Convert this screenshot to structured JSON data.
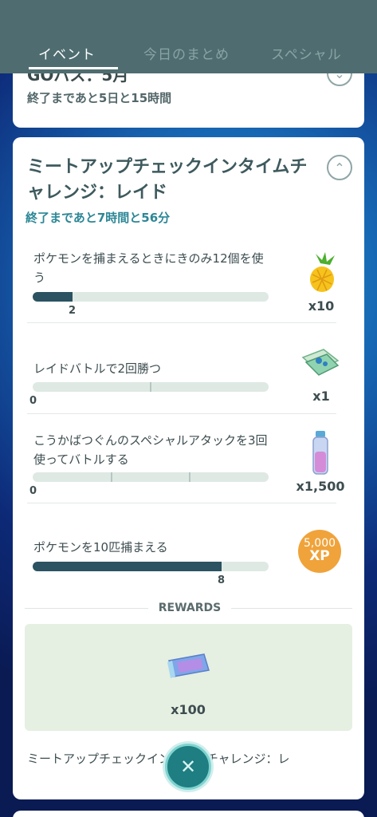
{
  "tabs": [
    {
      "label": "イベント",
      "active": true
    },
    {
      "label": "今日のまとめ",
      "active": false
    },
    {
      "label": "スペシャル",
      "active": false
    }
  ],
  "card1": {
    "title_partial": "GOパス：5月",
    "time_left": "終了まであと5日と15時間"
  },
  "event": {
    "title": "ミートアップチェックインタイムチャレンジ：レイド",
    "time_left": "終了まであと7時間と56分"
  },
  "tasks": [
    {
      "label": "ポケモンを捕まえるときにきのみ12個を使う",
      "progress": 2,
      "goal": 12,
      "progress_label": "2",
      "reward_amount": "x10",
      "reward_icon": "pinap-berry-icon"
    },
    {
      "label": "レイドバトルで2回勝つ",
      "progress": 0,
      "goal": 2,
      "progress_label": "0",
      "reward_amount": "x1",
      "reward_icon": "raid-pass-icon"
    },
    {
      "label": "こうかばつぐんのスペシャルアタックを3回使ってバトルする",
      "progress": 0,
      "goal": 3,
      "progress_label": "0",
      "reward_amount": "x1,500",
      "reward_icon": "stardust-vial-icon"
    },
    {
      "label": "ポケモンを10匹捕まえる",
      "progress": 8,
      "goal": 10,
      "progress_label": "8",
      "reward_amount": "",
      "reward_icon": "xp-badge-icon",
      "xp_value": "5,000",
      "xp_label": "XP"
    }
  ],
  "rewards": {
    "title": "REWARDS",
    "amount": "x100",
    "icon": "ticket-icon"
  },
  "bottom_text": "ミートアップチェックインタイムチャレンジ：レ",
  "colors": {
    "tab_bar": "#4f6d70",
    "accent_teal": "#2c8796",
    "progress_fill": "#2b5361",
    "progress_track": "#dfe9e4",
    "xp_badge": "#f0a33a",
    "rewards_bg": "#e5efe2"
  }
}
